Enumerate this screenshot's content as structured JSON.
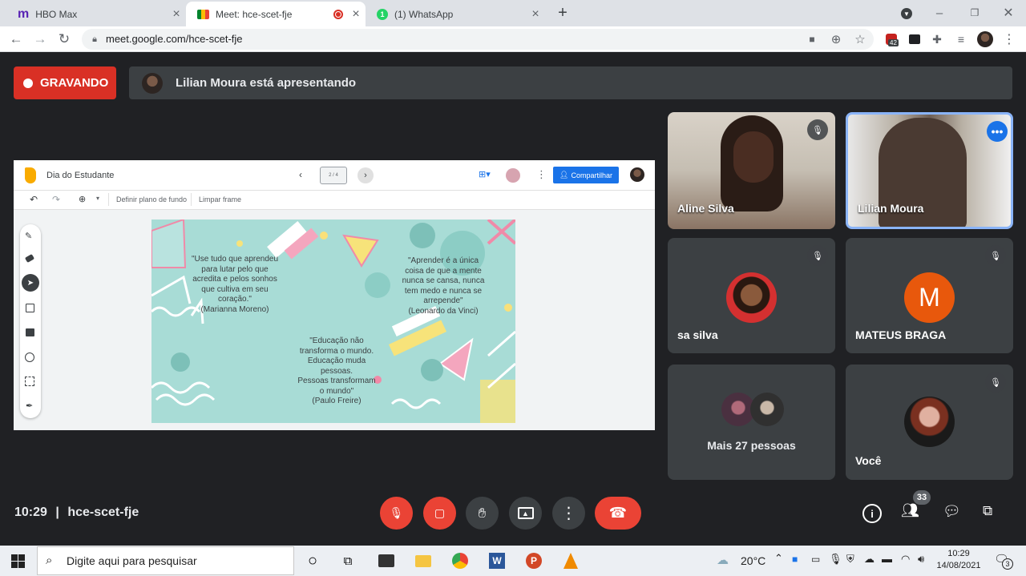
{
  "browser": {
    "tabs": [
      {
        "title": "HBO Max",
        "icon": "hbo-max-icon"
      },
      {
        "title": "Meet: hce-scet-fje",
        "icon": "google-meet-icon"
      },
      {
        "title": "(1) WhatsApp",
        "icon": "whatsapp-icon",
        "badge": "1"
      }
    ],
    "url": "meet.google.com/hce-scet-fje",
    "extension_badge": "42"
  },
  "meet": {
    "recording_label": "GRAVANDO",
    "presenting_text": "Lilian Moura está apresentando",
    "meeting_time": "10:29",
    "separator": "|",
    "meeting_code": "hce-scet-fje",
    "participants_count": "33"
  },
  "jamboard": {
    "title": "Dia do Estudante",
    "frame_indicator": "2 / 4",
    "share_label": "Compartilhar",
    "toolbar": {
      "set_background": "Definir plano de fundo",
      "clear_frame": "Limpar frame"
    },
    "quotes": {
      "q1": [
        "\"Use tudo que aprendeu",
        "para lutar pelo que",
        "acredita e pelos sonhos",
        "que cultiva em seu",
        "coração.\"",
        "(Marianna Moreno)"
      ],
      "q2": [
        "\"Aprender é a única",
        "coisa de que a mente",
        "nunca se cansa, nunca",
        "tem medo e nunca se",
        "arrepende\"",
        "(Leonardo da Vinci)"
      ],
      "q3": [
        "\"Educação não",
        "transforma o mundo.",
        "Educação muda",
        "pessoas.",
        "Pessoas transformam",
        "o mundo\"",
        "(Paulo Freire)"
      ]
    }
  },
  "participants": [
    {
      "name": "Aline Silva",
      "kind": "video"
    },
    {
      "name": "Lilian Moura",
      "kind": "video"
    },
    {
      "name": "sa silva",
      "kind": "avatar-photo"
    },
    {
      "name": "MATEUS BRAGA",
      "kind": "avatar-letter",
      "letter": "M",
      "color": "#e8580c"
    },
    {
      "name": "Mais 27 pessoas",
      "kind": "group"
    },
    {
      "name": "Você",
      "kind": "avatar-photo"
    }
  ],
  "taskbar": {
    "search_placeholder": "Digite aqui para pesquisar",
    "weather": "20°C",
    "time": "10:29",
    "date": "14/08/2021",
    "notification_count": "3"
  },
  "colors": {
    "meet_bg": "#202124",
    "tile": "#3c4043",
    "red": "#ea4335",
    "accent_blue": "#1a73e8"
  }
}
